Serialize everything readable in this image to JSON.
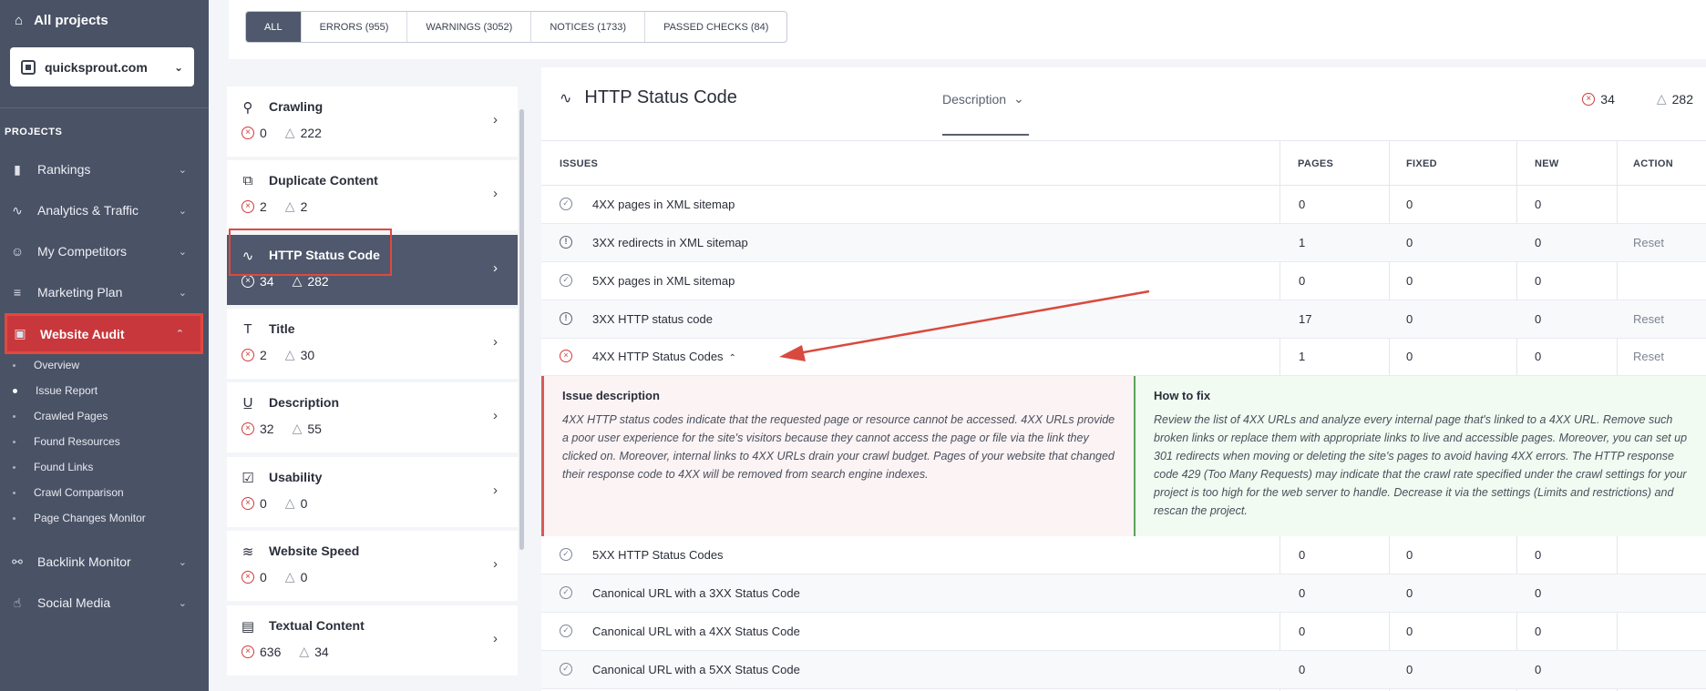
{
  "sidebar": {
    "all_projects": "All projects",
    "project": "quicksprout.com",
    "projects_label": "PROJECTS",
    "nav": [
      {
        "label": "Rankings",
        "icon": "bar-chart-icon"
      },
      {
        "label": "Analytics & Traffic",
        "icon": "pulse-icon"
      },
      {
        "label": "My Competitors",
        "icon": "users-icon"
      },
      {
        "label": "Marketing Plan",
        "icon": "checklist-icon"
      },
      {
        "label": "Website Audit",
        "icon": "audit-icon"
      },
      {
        "label": "Backlink Monitor",
        "icon": "link-icon"
      },
      {
        "label": "Social Media",
        "icon": "thumbs-up-icon"
      }
    ],
    "sub": [
      "Overview",
      "Issue Report",
      "Crawled Pages",
      "Found Resources",
      "Found Links",
      "Crawl Comparison",
      "Page Changes Monitor"
    ]
  },
  "filters": [
    "ALL",
    "ERRORS (955)",
    "WARNINGS (3052)",
    "NOTICES (1733)",
    "PASSED CHECKS (84)"
  ],
  "categories": [
    {
      "name": "Crawling",
      "errors": "0",
      "warnings": "222"
    },
    {
      "name": "Duplicate Content",
      "errors": "2",
      "warnings": "2"
    },
    {
      "name": "HTTP Status Code",
      "errors": "34",
      "warnings": "282"
    },
    {
      "name": "Title",
      "errors": "2",
      "warnings": "30"
    },
    {
      "name": "Description",
      "errors": "32",
      "warnings": "55"
    },
    {
      "name": "Usability",
      "errors": "0",
      "warnings": "0"
    },
    {
      "name": "Website Speed",
      "errors": "0",
      "warnings": "0"
    },
    {
      "name": "Textual Content",
      "errors": "636",
      "warnings": "34"
    }
  ],
  "main": {
    "title": "HTTP Status Code",
    "view": "Description",
    "errors": "34",
    "warnings": "282",
    "columns": [
      "ISSUES",
      "PAGES",
      "FIXED",
      "NEW",
      "ACTION"
    ],
    "rows": [
      {
        "issue": "4XX pages in XML sitemap",
        "pages": "0",
        "fixed": "0",
        "new": "0",
        "action": ""
      },
      {
        "issue": "3XX redirects in XML sitemap",
        "pages": "1",
        "fixed": "0",
        "new": "0",
        "action": "Reset"
      },
      {
        "issue": "5XX pages in XML sitemap",
        "pages": "0",
        "fixed": "0",
        "new": "0",
        "action": ""
      },
      {
        "issue": "3XX HTTP status code",
        "pages": "17",
        "fixed": "0",
        "new": "0",
        "action": "Reset"
      },
      {
        "issue": "4XX HTTP Status Codes",
        "pages": "1",
        "fixed": "0",
        "new": "0",
        "action": "Reset"
      },
      {
        "issue": "5XX HTTP Status Codes",
        "pages": "0",
        "fixed": "0",
        "new": "0",
        "action": ""
      },
      {
        "issue": "Canonical URL with a 3XX Status Code",
        "pages": "0",
        "fixed": "0",
        "new": "0",
        "action": ""
      },
      {
        "issue": "Canonical URL with a 4XX Status Code",
        "pages": "0",
        "fixed": "0",
        "new": "0",
        "action": ""
      },
      {
        "issue": "Canonical URL with a 5XX Status Code",
        "pages": "0",
        "fixed": "0",
        "new": "0",
        "action": ""
      }
    ],
    "detail": {
      "issue_title": "Issue description",
      "issue_text": "4XX HTTP status codes indicate that the requested page or resource cannot be accessed. 4XX URLs provide a poor user experience for the site's visitors because they cannot access the page or file via the link they clicked on. Moreover, internal links to 4XX URLs drain your crawl budget. Pages of your website that changed their response code to 4XX will be removed from search engine indexes.",
      "fix_title": "How to fix",
      "fix_text": "Review the list of 4XX URLs and analyze every internal page that's linked to a 4XX URL. Remove such broken links or replace them with appropriate links to live and accessible pages. Moreover, you can set up 301 redirects when moving or deleting the site's pages to avoid having 4XX errors. The HTTP response code 429 (Too Many Requests) may indicate that the crawl rate specified under the crawl settings for your project is too high for the web server to handle. Decrease it via the settings (Limits and restrictions) and rescan the project."
    }
  },
  "colors": {
    "sidebar": "#4a5266",
    "active_red": "#c8373b",
    "annotation": "#d94a3e"
  }
}
